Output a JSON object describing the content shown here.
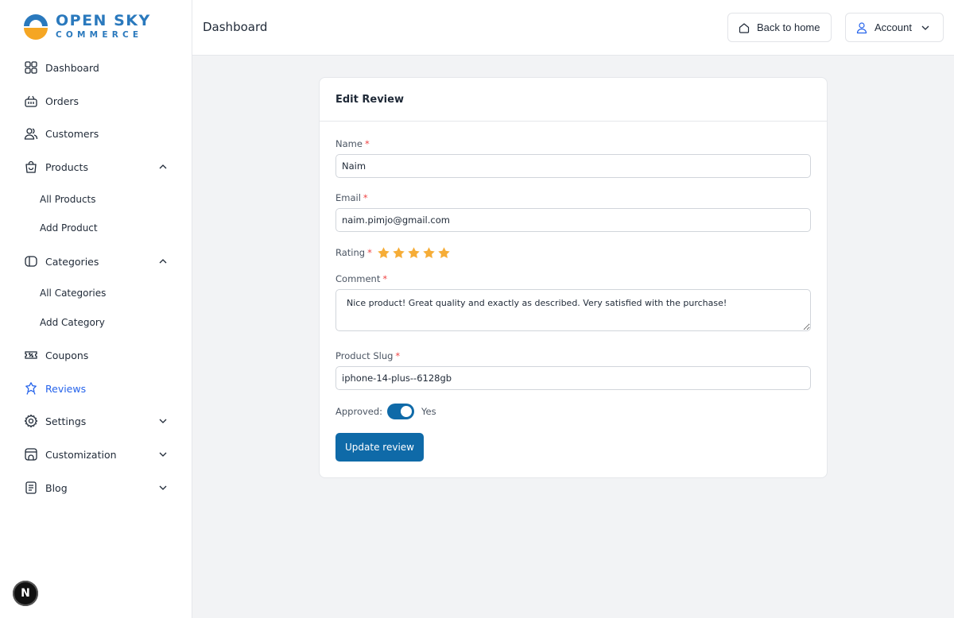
{
  "brand": {
    "name_top": "OPEN SKY",
    "name_bottom": "COMMERCE",
    "accent": "#2a79bd",
    "sun": "#f5a623"
  },
  "sidebar": {
    "items": [
      {
        "label": "Dashboard",
        "icon": "grid-icon"
      },
      {
        "label": "Orders",
        "icon": "basket-icon"
      },
      {
        "label": "Customers",
        "icon": "users-icon"
      },
      {
        "label": "Products",
        "icon": "bag-icon",
        "expanded": true
      },
      {
        "label": "Categories",
        "icon": "tag-icon",
        "expanded": true
      },
      {
        "label": "Coupons",
        "icon": "coupon-icon"
      },
      {
        "label": "Reviews",
        "icon": "star-badge-icon",
        "active": true
      },
      {
        "label": "Settings",
        "icon": "gear-icon",
        "expanded": false
      },
      {
        "label": "Customization",
        "icon": "palette-icon",
        "expanded": false
      },
      {
        "label": "Blog",
        "icon": "document-icon",
        "expanded": false
      }
    ],
    "products_sub": [
      "All Products",
      "Add Product"
    ],
    "categories_sub": [
      "All Categories",
      "Add Category"
    ]
  },
  "framework_badge": "N",
  "header": {
    "title": "Dashboard",
    "back_home": "Back to home",
    "account": "Account"
  },
  "form": {
    "title": "Edit Review",
    "name_label": "Name",
    "name_value": "Naim",
    "email_label": "Email",
    "email_value": "naim.pimjo@gmail.com",
    "rating_label": "Rating",
    "rating_value": 5,
    "rating_max": 5,
    "comment_label": "Comment",
    "comment_value": "Nice product! Great quality and exactly as described. Very satisfied with the purchase!",
    "slug_label": "Product Slug",
    "slug_value": "iphone-14-plus--6128gb",
    "approved_label": "Approved:",
    "approved_value": true,
    "approved_text": "Yes",
    "required_mark": "*",
    "submit_label": "Update review"
  },
  "colors": {
    "primary": "#0f6aa8",
    "active_nav": "#2563eb",
    "star": "#f6ad37",
    "required": "#ef4444"
  }
}
